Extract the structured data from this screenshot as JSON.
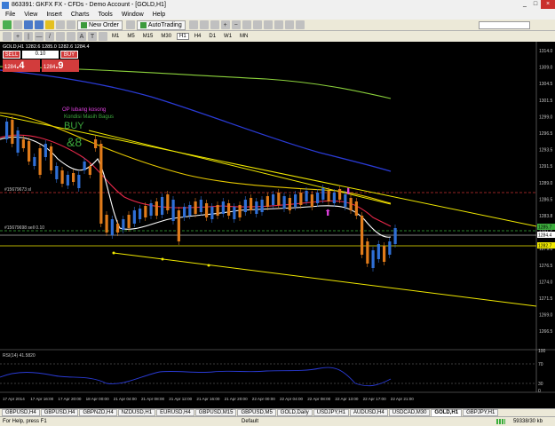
{
  "window": {
    "title": "863391: GKFX FX - CFDs - Demo Account - [GOLD,H1]",
    "controls": [
      "_",
      "□",
      "×"
    ]
  },
  "menu": [
    "File",
    "View",
    "Insert",
    "Charts",
    "Tools",
    "Window",
    "Help"
  ],
  "toolbar": {
    "new_order": "New Order",
    "autotrading": "AutoTrading",
    "timeframes": [
      "M1",
      "M5",
      "M15",
      "M30",
      "H1",
      "H4",
      "D1",
      "W1",
      "MN"
    ],
    "selected_timeframe": "H1"
  },
  "chart": {
    "header": "GOLD,H1  1282.6 1285.0 1282.6 1284.4",
    "trade": {
      "sell": "SELL",
      "buy": "BUY",
      "volume": "0.10",
      "sell_price_small": "1284",
      "sell_price_big": ".4",
      "buy_price_small": "1284",
      "buy_price_big": ".9"
    },
    "annotations": {
      "op_text": "OP lubang kosong",
      "kondisi": "Kondisi Masih Bagus",
      "buy": "BUY",
      "glyph": "&8",
      "order_line_1": "#15679673 sl",
      "order_line_2": "#15679698 sell 0.10"
    },
    "price_labels": [
      "1314.0",
      "1309.0",
      "1304.5",
      "1301.5",
      "1299.0",
      "1296.5",
      "1293.5",
      "1291.5",
      "1289.0",
      "1286.5",
      "1283.8",
      "1281.5",
      "1279.0",
      "1276.5",
      "1274.0",
      "1271.5",
      "1269.0",
      "1266.5"
    ],
    "current_price": "1284.4",
    "highlight_prices": [
      "1285.7",
      "1284.4",
      "1282.7"
    ],
    "rsi_label": "RSI(14) 41.5820",
    "rsi_levels": [
      "70",
      "30"
    ],
    "rsi_right_labels": [
      "100",
      "70",
      "30",
      "0"
    ],
    "time_labels": [
      "17 Apr 2014",
      "17 Apr 16:00",
      "17 Apr 20:00",
      "18 Apr 00:00",
      "21 Apr 04:00",
      "21 Apr 08:00",
      "21 Apr 12:00",
      "21 Apr 16:00",
      "21 Apr 20:00",
      "22 Apr 00:00",
      "22 Apr 04:00",
      "22 Apr 08:00",
      "22 Apr 13:00",
      "22 Apr 17:00",
      "22 Apr 21:00"
    ],
    "colors": {
      "background": "#000000",
      "up_candle": "#2f6fd6",
      "down_candle": "#e07b1a",
      "channel": "#f0e800",
      "ma_slow": "#8cd33c",
      "ma_blue": "#2a3bd6",
      "ma_red": "#e8284a",
      "ma_white": "#ffffff",
      "ma_yellow": "#e6c800"
    }
  },
  "tabs": [
    "GBPUSD,H4",
    "GBPUSD,H4",
    "GBPNZD,H4",
    "NZDUSD,H1",
    "EURUSD,H4",
    "GBPUSD,M15",
    "GBPUSD,M5",
    "GOLD,Daily",
    "USDJPY,H1",
    "AUDUSD,H4",
    "USDCAD,M30",
    "GOLD,H1",
    "GBPJPY,H1"
  ],
  "active_tab": "GOLD,H1",
  "status": {
    "help": "For Help, press F1",
    "profile": "Default",
    "traffic": "59338/30 kb"
  }
}
